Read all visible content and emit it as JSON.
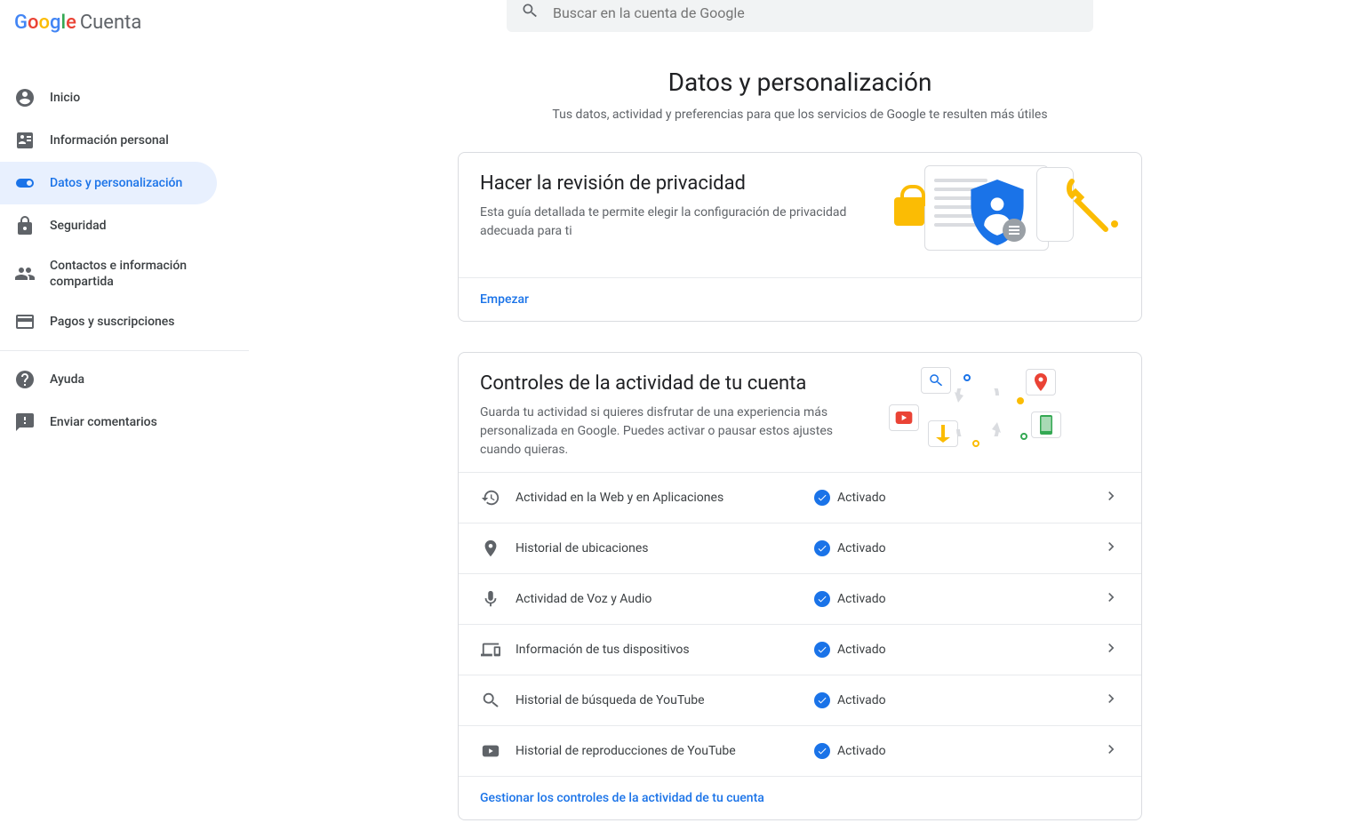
{
  "header": {
    "logo_text": "Google",
    "logo_sub": "Cuenta",
    "search_placeholder": "Buscar en la cuenta de Google"
  },
  "sidebar": {
    "items": [
      {
        "label": "Inicio"
      },
      {
        "label": "Información personal"
      },
      {
        "label": "Datos y personalización"
      },
      {
        "label": "Seguridad"
      },
      {
        "label": "Contactos e información compartida"
      },
      {
        "label": "Pagos y suscripciones"
      }
    ],
    "footer": [
      {
        "label": "Ayuda"
      },
      {
        "label": "Enviar comentarios"
      }
    ]
  },
  "page": {
    "title": "Datos y personalización",
    "subtitle": "Tus datos, actividad y preferencias para que los servicios de Google te resulten más útiles"
  },
  "privacy_card": {
    "title": "Hacer la revisión de privacidad",
    "desc": "Esta guía detallada te permite elegir la configuración de privacidad adecuada para ti",
    "cta": "Empezar"
  },
  "activity_card": {
    "title": "Controles de la actividad de tu cuenta",
    "desc": "Guarda tu actividad si quieres disfrutar de una experiencia más personalizada en Google. Puedes activar o pausar estos ajustes cuando quieras.",
    "rows": [
      {
        "label": "Actividad en la Web y en Aplicaciones",
        "status": "Activado"
      },
      {
        "label": "Historial de ubicaciones",
        "status": "Activado"
      },
      {
        "label": "Actividad de Voz y Audio",
        "status": "Activado"
      },
      {
        "label": "Información de tus dispositivos",
        "status": "Activado"
      },
      {
        "label": "Historial de búsqueda de YouTube",
        "status": "Activado"
      },
      {
        "label": "Historial de reproducciones de YouTube",
        "status": "Activado"
      }
    ],
    "cta": "Gestionar los controles de la actividad de tu cuenta"
  }
}
